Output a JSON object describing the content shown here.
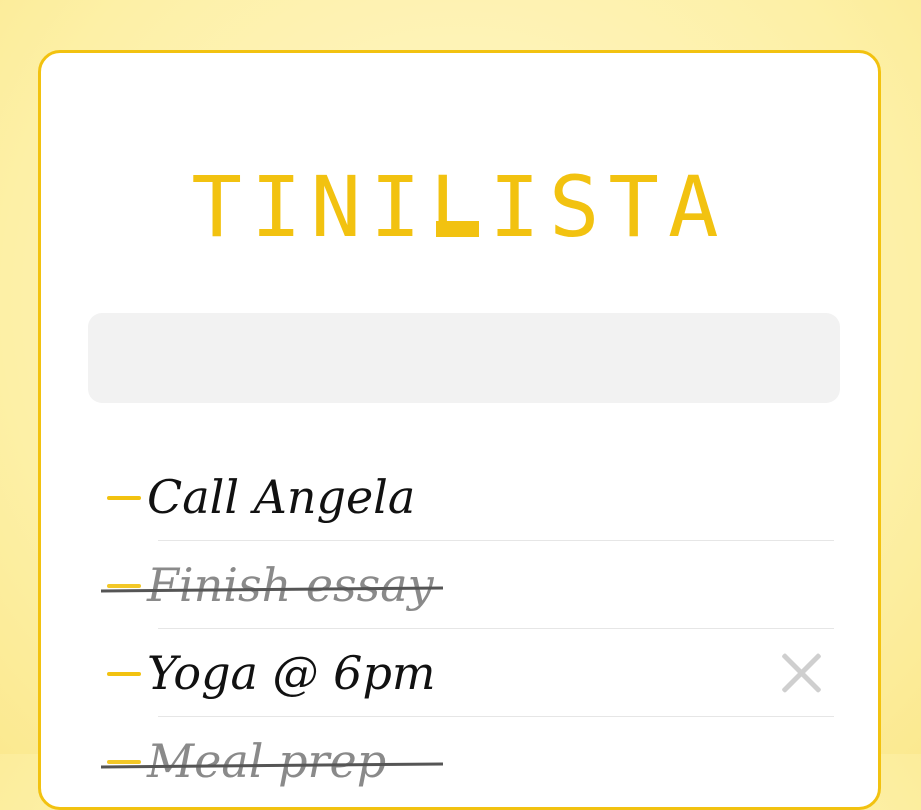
{
  "app": {
    "title_prefix": "TINI",
    "title_accent": "L",
    "title_suffix": "ISTA"
  },
  "new_todo": {
    "value": "",
    "placeholder": ""
  },
  "todos": [
    {
      "text": "Call Angela",
      "completed": false
    },
    {
      "text": "Finish essay",
      "completed": true
    },
    {
      "text": "Yoga @ 6pm",
      "completed": false,
      "delete_icon": "close-icon"
    },
    {
      "text": "Meal prep",
      "completed": true
    }
  ],
  "colors": {
    "accent": "#f2c210",
    "background": "#fdf0a6",
    "card": "#ffffff",
    "input_bg": "#f2f2f2",
    "done_text": "#8a8a8a",
    "delete_icon": "#cfcfcf"
  }
}
